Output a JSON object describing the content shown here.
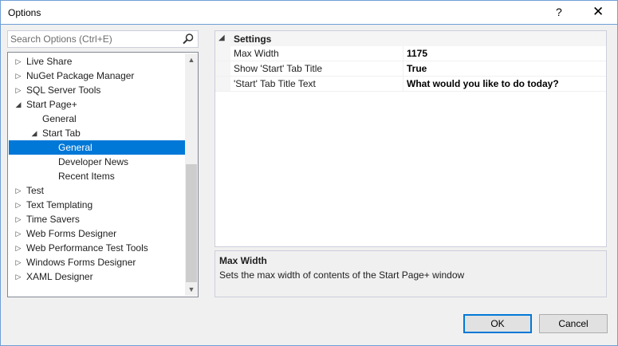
{
  "window": {
    "title": "Options",
    "help_glyph": "?",
    "close_glyph": "✕"
  },
  "search": {
    "placeholder": "Search Options (Ctrl+E)",
    "value": "",
    "icon": "search-icon"
  },
  "tree": {
    "items": [
      {
        "label": "Live Share",
        "arrow": "▷",
        "level": 0
      },
      {
        "label": "NuGet Package Manager",
        "arrow": "▷",
        "level": 0
      },
      {
        "label": "SQL Server Tools",
        "arrow": "▷",
        "level": 0
      },
      {
        "label": "Start Page+",
        "arrow": "◢",
        "level": 0
      },
      {
        "label": "General",
        "arrow": "",
        "level": 1
      },
      {
        "label": "Start Tab",
        "arrow": "◢",
        "level": 1
      },
      {
        "label": "General",
        "arrow": "",
        "level": 2,
        "selected": true
      },
      {
        "label": "Developer News",
        "arrow": "",
        "level": 2
      },
      {
        "label": "Recent Items",
        "arrow": "",
        "level": 2
      },
      {
        "label": "Test",
        "arrow": "▷",
        "level": 0
      },
      {
        "label": "Text Templating",
        "arrow": "▷",
        "level": 0
      },
      {
        "label": "Time Savers",
        "arrow": "▷",
        "level": 0
      },
      {
        "label": "Web Forms Designer",
        "arrow": "▷",
        "level": 0
      },
      {
        "label": "Web Performance Test Tools",
        "arrow": "▷",
        "level": 0
      },
      {
        "label": "Windows Forms Designer",
        "arrow": "▷",
        "level": 0
      },
      {
        "label": "XAML Designer",
        "arrow": "▷",
        "level": 0
      }
    ],
    "scroll_up_glyph": "▲",
    "scroll_down_glyph": "▼"
  },
  "property_grid": {
    "category": {
      "name": "Settings",
      "expand_glyph": "◢"
    },
    "properties": [
      {
        "name": "Max Width",
        "value": "1175"
      },
      {
        "name": "Show 'Start' Tab Title",
        "value": "True"
      },
      {
        "name": "'Start' Tab Title Text",
        "value": "What would you like to do today?"
      }
    ]
  },
  "description": {
    "title": "Max Width",
    "text": "Sets the max width of contents of the Start Page+ window"
  },
  "buttons": {
    "ok": "OK",
    "cancel": "Cancel"
  },
  "colors": {
    "selection": "#0078d7",
    "window_border": "#6f9fd6",
    "dialog_bg": "#f0f0f0"
  }
}
